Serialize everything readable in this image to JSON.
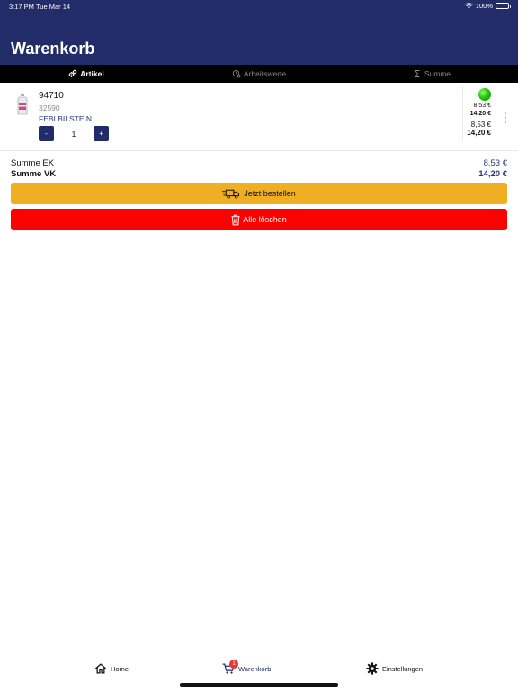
{
  "status_bar": {
    "time": "3:17 PM",
    "date": "Tue Mar 14",
    "battery": "100%"
  },
  "header": {
    "title": "Warenkorb"
  },
  "tabs": [
    {
      "label": "Artikel",
      "icon": "gears-icon",
      "active": true
    },
    {
      "label": "Arbeitswerte",
      "icon": "clock-gear-icon",
      "active": false
    },
    {
      "label": "Summe",
      "icon": "sigma-icon",
      "active": false
    }
  ],
  "cart_item": {
    "article_number": "94710",
    "reference_number": "32590",
    "brand": "FEBI BILSTEIN",
    "quantity": "1",
    "minus_label": "-",
    "plus_label": "+",
    "availability_color": "#28c414",
    "price_ek_unit": "8,53 €",
    "price_vk_unit": "14,20 €",
    "price_ek_total": "8,53 €",
    "price_vk_total": "14,20 €"
  },
  "summary": {
    "ek_label": "Summe EK",
    "ek_value": "8,53 €",
    "vk_label": "Summe VK",
    "vk_value": "14,20 €"
  },
  "actions": {
    "order_label": "Jetzt bestellen",
    "delete_label": "Alle löschen"
  },
  "bottom_nav": {
    "home_label": "Home",
    "cart_label": "Warenkorb",
    "cart_badge": "1",
    "settings_label": "Einstellungen"
  },
  "colors": {
    "header": "#212c68",
    "order_button": "#f0ae23",
    "delete_button": "#ff0000"
  }
}
